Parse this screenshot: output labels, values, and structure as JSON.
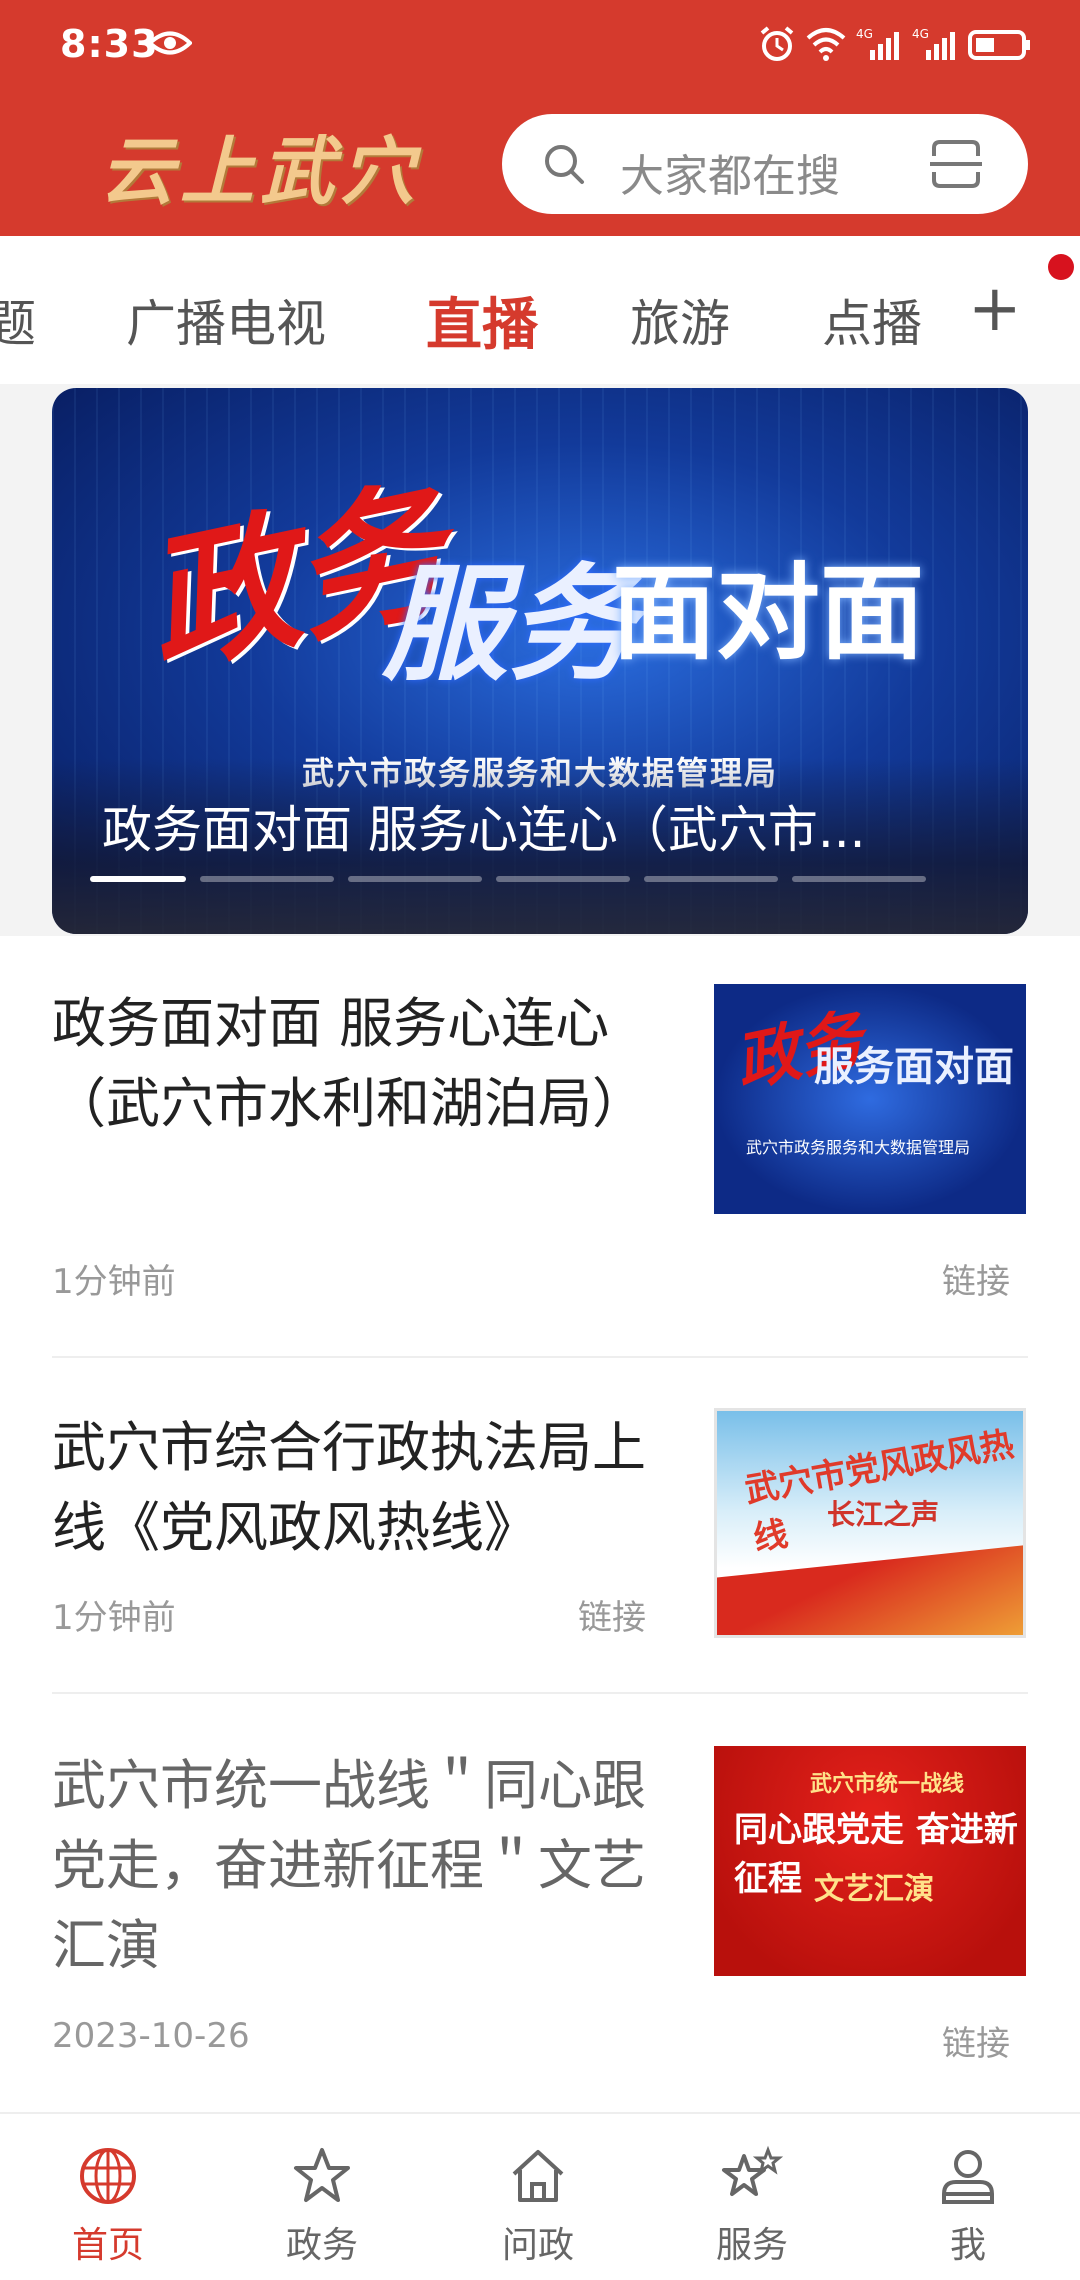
{
  "status": {
    "time": "8:33",
    "network": "4G",
    "network2": "4G"
  },
  "header": {
    "logo_text": "云上武穴",
    "search_placeholder": "大家都在搜"
  },
  "tabs": [
    {
      "label": "题"
    },
    {
      "label": "广播电视"
    },
    {
      "label": "直播",
      "active": true
    },
    {
      "label": "旅游"
    },
    {
      "label": "点播"
    }
  ],
  "tab_add_label": "+",
  "banner": {
    "title": "政务面对面 服务心连心（武穴市...",
    "art_a": "政务",
    "art_b": "服务",
    "art_c": "面对面",
    "subtitle": "武穴市政务服务和大数据管理局",
    "slide_count": 6,
    "active_slide": 1
  },
  "articles": [
    {
      "title": "政务面对面 服务心连心（武穴市水利和湖泊局）",
      "time": "1分钟前",
      "tag": "链接",
      "thumb": {
        "a": "政务",
        "b": "服务面对面",
        "c": "武穴市政务服务和大数据管理局"
      }
    },
    {
      "title": "武穴市综合行政执法局上线《党风政风热线》",
      "time": "1分钟前",
      "tag": "链接",
      "thumb": {
        "a": "武穴市党风政风热线",
        "b": "长江之声"
      }
    },
    {
      "title": "武穴市统一战线＂同心跟党走，奋进新征程＂文艺汇演",
      "time": "2023-10-26",
      "tag": "链接",
      "thumb": {
        "a": "武穴市统一战线",
        "b": "同心跟党走 奋进新征程",
        "c": "文艺汇演"
      }
    }
  ],
  "bottom_nav": [
    {
      "label": "首页",
      "icon": "globe-icon",
      "active": true
    },
    {
      "label": "政务",
      "icon": "star-icon"
    },
    {
      "label": "问政",
      "icon": "home-icon"
    },
    {
      "label": "服务",
      "icon": "stars-icon"
    },
    {
      "label": "我",
      "icon": "user-icon"
    }
  ],
  "colors": {
    "brand_red": "#d53a2d",
    "text_dark": "#222222",
    "text_gray": "#999999"
  }
}
